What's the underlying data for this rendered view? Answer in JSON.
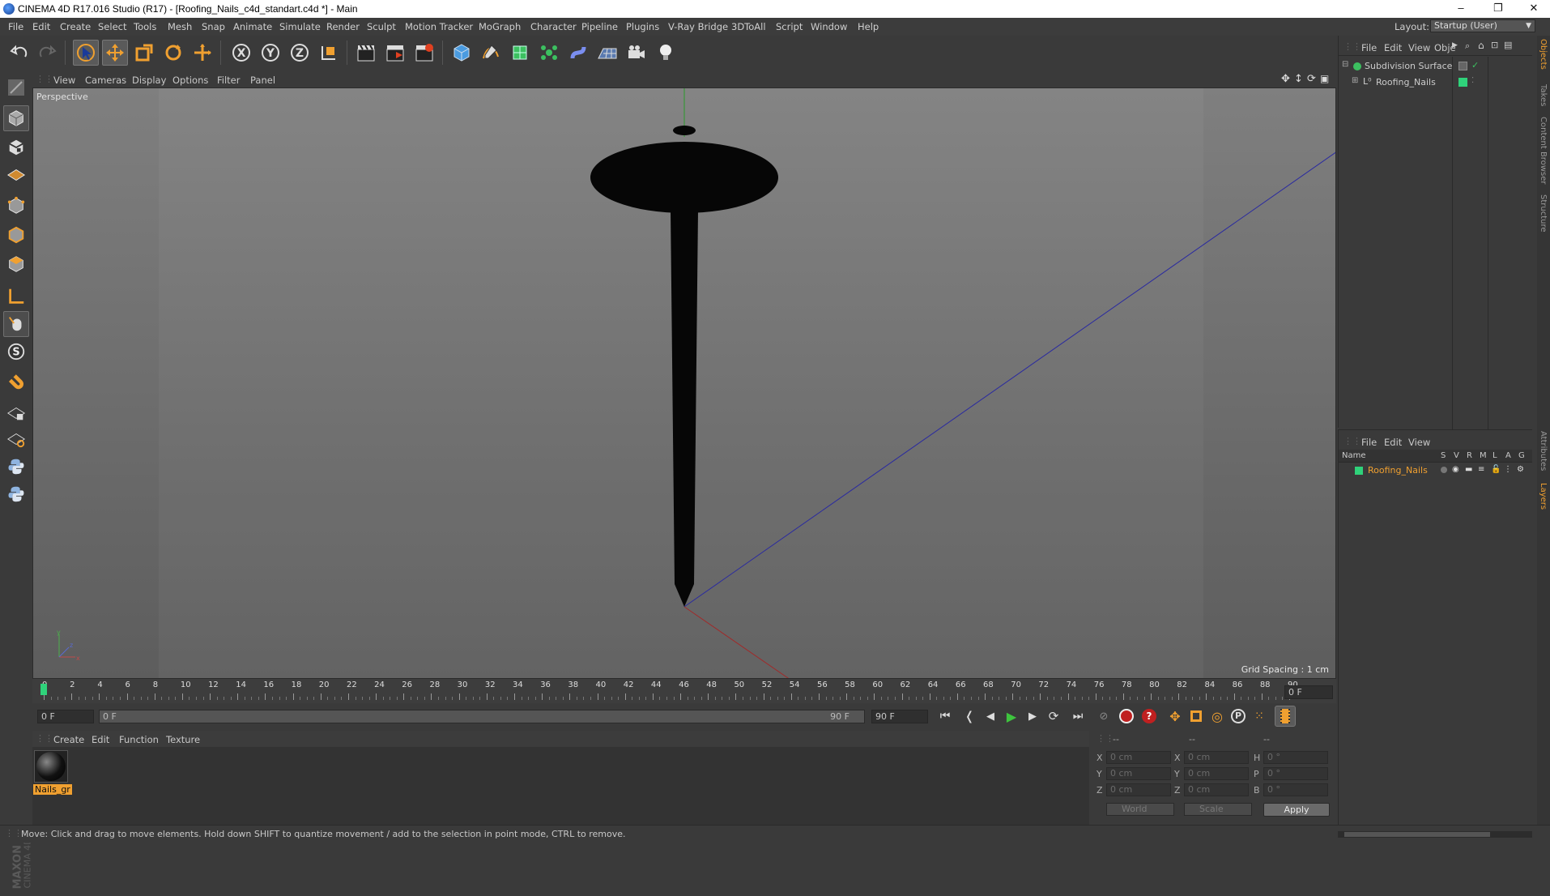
{
  "window": {
    "title": "CINEMA 4D R17.016 Studio (R17) - [Roofing_Nails_c4d_standart.c4d *] - Main",
    "minimize": "–",
    "maximize": "❐",
    "close": "✕"
  },
  "menubar": {
    "items": [
      "File",
      "Edit",
      "Create",
      "Select",
      "Tools",
      "Mesh",
      "Snap",
      "Animate",
      "Simulate",
      "Render",
      "Sculpt",
      "Motion Tracker",
      "MoGraph",
      "Character",
      "Pipeline",
      "Plugins",
      "V-Ray Bridge",
      "3DToAll",
      "Script",
      "Window",
      "Help"
    ],
    "layout_label": "Layout:",
    "layout_value": "Startup (User)"
  },
  "viewport": {
    "menu": [
      "View",
      "Cameras",
      "Display",
      "Options",
      "Filter",
      "Panel"
    ],
    "camera_label": "Perspective",
    "grid_spacing": "Grid Spacing : 1 cm"
  },
  "timeline": {
    "ticks": [
      "0",
      "2",
      "4",
      "6",
      "8",
      "10",
      "12",
      "14",
      "16",
      "18",
      "20",
      "22",
      "24",
      "26",
      "28",
      "30",
      "32",
      "34",
      "36",
      "38",
      "40",
      "42",
      "44",
      "46",
      "48",
      "50",
      "52",
      "54",
      "56",
      "58",
      "60",
      "62",
      "64",
      "66",
      "68",
      "70",
      "72",
      "74",
      "76",
      "78",
      "80",
      "82",
      "84",
      "86",
      "88",
      "90"
    ],
    "current_frame": "0 F",
    "start_field": "0 F",
    "range_start": "0 F",
    "range_end": "90 F",
    "end_field": "90 F"
  },
  "material_manager": {
    "menu": [
      "Create",
      "Edit",
      "Function",
      "Texture"
    ],
    "materials": [
      {
        "name": "Nails_gr"
      }
    ]
  },
  "coordinates": {
    "headers": [
      "--",
      "--",
      "--"
    ],
    "rows": [
      {
        "axis": "X",
        "pos": "0 cm",
        "axis2": "X",
        "size": "0 cm",
        "rot_axis": "H",
        "rot": "0 °"
      },
      {
        "axis": "Y",
        "pos": "0 cm",
        "axis2": "Y",
        "size": "0 cm",
        "rot_axis": "P",
        "rot": "0 °"
      },
      {
        "axis": "Z",
        "pos": "0 cm",
        "axis2": "Z",
        "size": "0 cm",
        "rot_axis": "B",
        "rot": "0 °"
      }
    ],
    "mode1": "World",
    "mode2": "Scale",
    "apply": "Apply"
  },
  "object_manager": {
    "menu": [
      "File",
      "Edit",
      "View",
      "Obje"
    ],
    "objects": [
      {
        "name": "Subdivision Surface",
        "level": 0
      },
      {
        "name": "Roofing_Nails",
        "level": 1
      }
    ]
  },
  "layer_manager": {
    "menu": [
      "File",
      "Edit",
      "View"
    ],
    "columns": {
      "name": "Name",
      "flags": [
        "S",
        "V",
        "R",
        "M",
        "L",
        "A",
        "G"
      ]
    },
    "layers": [
      {
        "name": "Roofing_Nails",
        "color": "#2fd27a"
      }
    ]
  },
  "side_tabs": [
    "Objects",
    "Takes",
    "Content Browser",
    "Structure",
    "Attributes",
    "Layers"
  ],
  "status": "Move: Click and drag to move elements. Hold down SHIFT to quantize movement / add to the selection in point mode, CTRL to remove.",
  "brand": {
    "line1": "MAXON",
    "line2": "CINEMA 4D"
  },
  "colors": {
    "accent": "#f0a030",
    "layer_green": "#2fd27a",
    "play_green": "#3ec43e"
  }
}
